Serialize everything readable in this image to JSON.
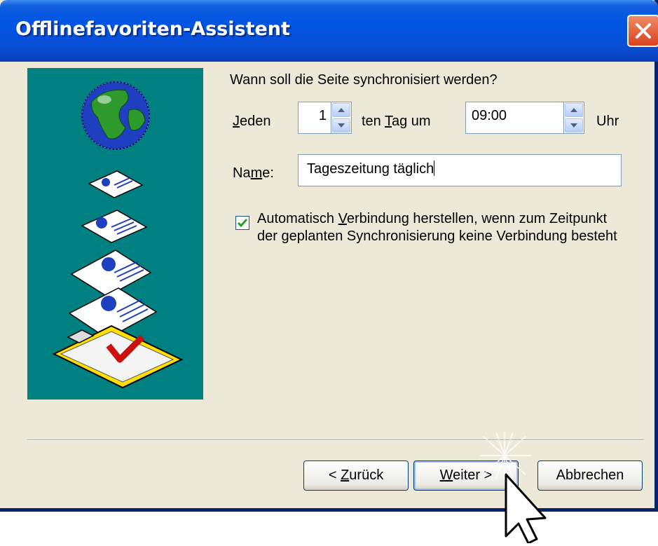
{
  "window": {
    "title": "Offlinefavoriten-Assistent"
  },
  "question": "Wann soll die Seite synchronisiert werden?",
  "schedule": {
    "every_prefix": "J",
    "every_rest": "eden",
    "day_value": "1",
    "day_suffix_a": "ten ",
    "day_suffix_u": "T",
    "day_suffix_b": "ag um",
    "time_value": "09:00",
    "time_unit": "Uhr"
  },
  "name": {
    "label_a": "Na",
    "label_u": "m",
    "label_b": "e:",
    "value": "Tageszeitung täglich"
  },
  "auto_connect": {
    "checked": true,
    "text_a": "Automatisch ",
    "text_u": "V",
    "text_b": "erbindung herstellen, wenn zum Zeitpunkt der geplanten Synchronisierung keine Verbindung besteht"
  },
  "buttons": {
    "back_a": "< ",
    "back_u": "Z",
    "back_b": "urück",
    "next_u": "W",
    "next_b": "eiter >",
    "cancel": "Abbrechen"
  },
  "colors": {
    "titlebar": "#0054e3",
    "sidebar": "#008080",
    "dialog": "#ece9d8",
    "close": "#e05a35"
  },
  "icons": [
    "globe-icon",
    "document-icon",
    "clipboard-icon",
    "close-icon",
    "mouse-cursor-icon",
    "checkmark-icon"
  ]
}
